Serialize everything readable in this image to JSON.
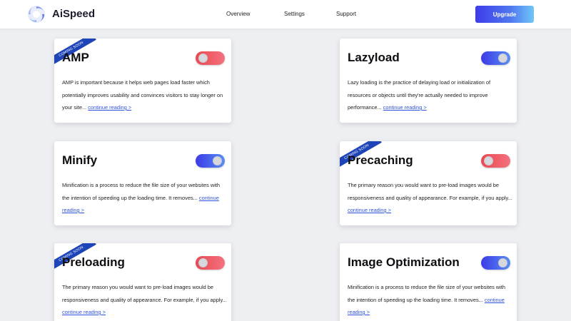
{
  "header": {
    "brand": "AiSpeed",
    "nav": [
      "Overview",
      "Settings",
      "Support"
    ],
    "upgrade_label": "Upgrade"
  },
  "colors": {
    "toggle_on": "#3b3be6",
    "toggle_off": "#e84850",
    "ribbon": "#1e45b8",
    "link": "#2f53d8"
  },
  "cards": [
    {
      "title": "AMP",
      "description": "AMP is important because it helps web pages load faster which potentially improves usability and convinces visitors to stay longer on your site...",
      "link": "continue reading >",
      "enabled": false,
      "ribbon": "COMING SOON"
    },
    {
      "title": "Lazyload",
      "description": "Lazy loading is the practice of delaying load or initialization of resources or objects until they're actually needed to improve performance...",
      "link": "continue reading >",
      "enabled": true,
      "ribbon": ""
    },
    {
      "title": "Minify",
      "description": "Minification is a process to reduce the file size of your websites with the intention of speeding up the loading time. It removes...",
      "link": "continue reading >",
      "enabled": true,
      "ribbon": ""
    },
    {
      "title": "Precaching",
      "description": "The primary reason you would want to pre-load images would be responsiveness and quality of appearance. For example, if you apply...",
      "link": "continue reading >",
      "enabled": false,
      "ribbon": "COMING SOON"
    },
    {
      "title": "Preloading",
      "description": "The primary reason you would want to pre-load images would be responsiveness and quality of appearance. For example, if you apply...",
      "link": "continue reading >",
      "enabled": false,
      "ribbon": "COMING SOON"
    },
    {
      "title": "Image Optimization",
      "description": "Minification is a process to reduce the file size of your websites with the intention of speeding up the loading time. It removes...",
      "link": "continue reading >",
      "enabled": true,
      "ribbon": ""
    }
  ]
}
